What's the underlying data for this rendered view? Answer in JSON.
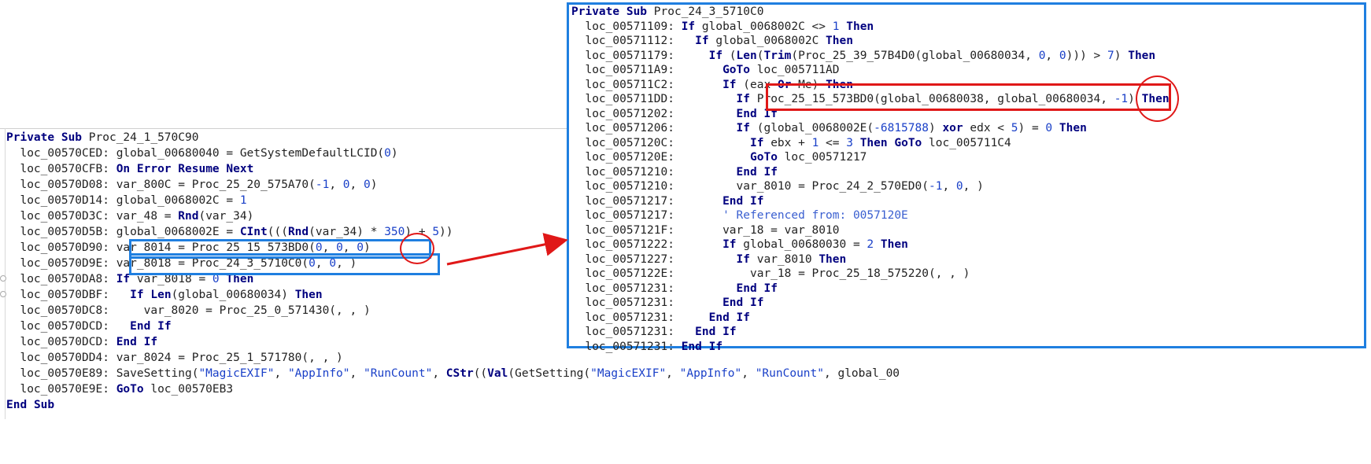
{
  "left_code": {
    "header": "Private Sub Proc_24_1_570C90",
    "lines": [
      {
        "label": "loc_00570CED:",
        "text": "global_00680040 = GetSystemDefaultLCID(0)"
      },
      {
        "label": "loc_00570CFB:",
        "text": "On Error Resume Next"
      },
      {
        "label": "loc_00570D08:",
        "text": "var_800C = Proc_25_20_575A70(-1, 0, 0)"
      },
      {
        "label": "loc_00570D14:",
        "text": "global_0068002C = 1"
      },
      {
        "label": "loc_00570D3C:",
        "text": "var_48 = Rnd(var_34)"
      },
      {
        "label": "loc_00570D5B:",
        "text": "global_0068002E = CInt(((Rnd(var_34) * 350) + 5))"
      },
      {
        "label": "loc_00570D90:",
        "text": "var_8014 = Proc_25_15_573BD0(0, 0, 0)"
      },
      {
        "label": "loc_00570D9E:",
        "text": "var_8018 = Proc_24_3_5710C0(0, 0, )"
      },
      {
        "label": "loc_00570DA8:",
        "text": "If var_8018 = 0 Then"
      },
      {
        "label": "loc_00570DBF:",
        "text": "  If Len(global_00680034) Then"
      },
      {
        "label": "loc_00570DC8:",
        "text": "    var_8020 = Proc_25_0_571430(, , )"
      },
      {
        "label": "loc_00570DCD:",
        "text": "  End If"
      },
      {
        "label": "loc_00570DCD:",
        "text": "End If"
      },
      {
        "label": "loc_00570DD4:",
        "text": "var_8024 = Proc_25_1_571780(, , )"
      },
      {
        "label": "loc_00570E89:",
        "text": "SaveSetting(\"MagicEXIF\", \"AppInfo\", \"RunCount\", CStr((Val(GetSetting(\"MagicEXIF\", \"AppInfo\", \"RunCount\", global_00"
      },
      {
        "label": "loc_00570E9E:",
        "text": "GoTo loc_00570EB3"
      }
    ],
    "footer": "End Sub"
  },
  "right_code": {
    "header": "Private Sub Proc_24_3_5710C0",
    "lines": [
      {
        "label": "loc_00571109:",
        "text": "If global_0068002C <> 1 Then"
      },
      {
        "label": "loc_00571112:",
        "text": "  If global_0068002C Then"
      },
      {
        "label": "loc_00571179:",
        "text": "    If (Len(Trim(Proc_25_39_57B4D0(global_00680034, 0, 0))) > 7) Then"
      },
      {
        "label": "loc_005711A9:",
        "text": "      GoTo loc_005711AD"
      },
      {
        "label": "loc_005711C2:",
        "text": "      If (eax Or Me) Then"
      },
      {
        "label": "loc_005711DD:",
        "text": "        If Proc_25_15_573BD0(global_00680038, global_00680034, -1) Then"
      },
      {
        "label": "loc_00571202:",
        "text": "        End If"
      },
      {
        "label": "loc_00571206:",
        "text": "        If (global_0068002E(-6815788) xor edx < 5) = 0 Then"
      },
      {
        "label": "loc_0057120C:",
        "text": "          If ebx + 1 <= 3 Then GoTo loc_005711C4"
      },
      {
        "label": "loc_0057120E:",
        "text": "          GoTo loc_00571217"
      },
      {
        "label": "loc_00571210:",
        "text": "        End If"
      },
      {
        "label": "loc_00571210:",
        "text": "        var_8010 = Proc_24_2_570ED0(-1, 0, )"
      },
      {
        "label": "loc_00571217:",
        "text": "      End If"
      },
      {
        "label": "loc_00571217:",
        "text": "      ' Referenced from: 0057120E"
      },
      {
        "label": "loc_0057121F:",
        "text": "      var_18 = var_8010"
      },
      {
        "label": "loc_00571222:",
        "text": "      If global_00680030 = 2 Then"
      },
      {
        "label": "loc_00571227:",
        "text": "        If var_8010 Then"
      },
      {
        "label": "loc_0057122E:",
        "text": "          var_18 = Proc_25_18_575220(, , )"
      },
      {
        "label": "loc_00571231:",
        "text": "        End If"
      },
      {
        "label": "loc_00571231:",
        "text": "      End If"
      },
      {
        "label": "loc_00571231:",
        "text": "    End If"
      },
      {
        "label": "loc_00571231:",
        "text": "  End If"
      },
      {
        "label": "loc_00571231:",
        "text": "End If"
      }
    ]
  },
  "colors": {
    "keyword": "#00007f",
    "literal": "#1a40c8",
    "highlight_blue": "#1f7fe0",
    "highlight_red": "#e01818"
  }
}
